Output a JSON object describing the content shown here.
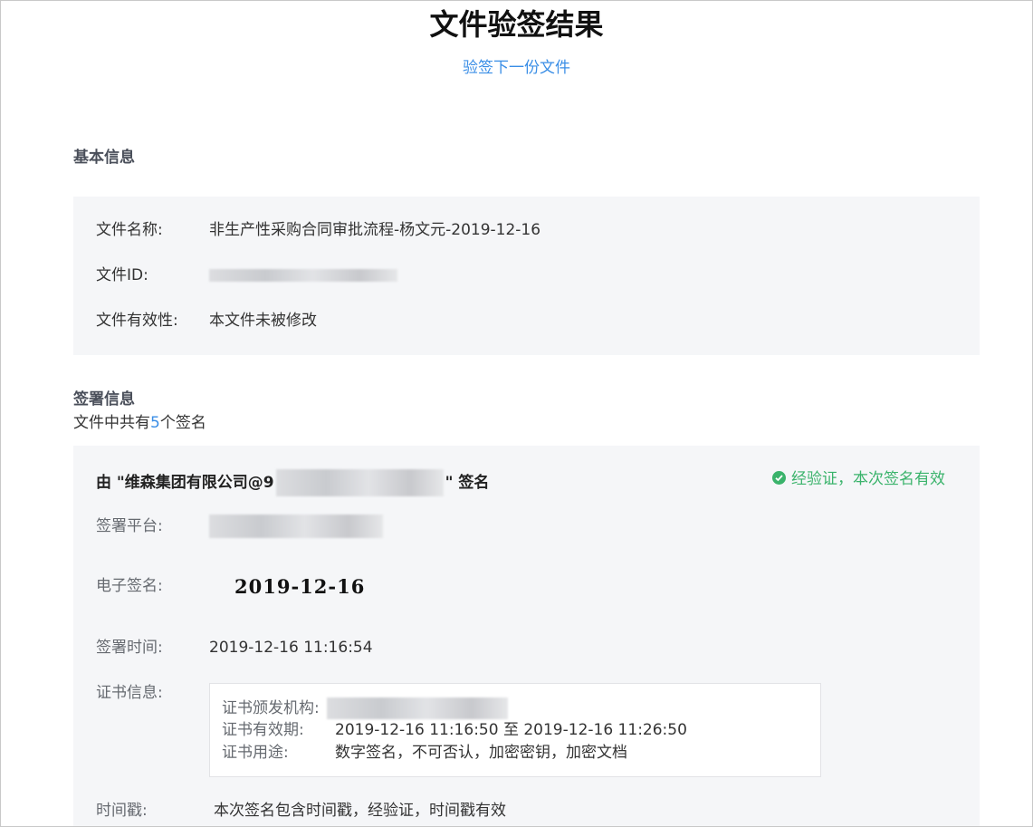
{
  "page": {
    "title": "文件验签结果",
    "next_link": "验签下一份文件"
  },
  "basic_info": {
    "heading": "基本信息",
    "rows": [
      {
        "label": "文件名称:",
        "value": "非生产性采购合同审批流程-杨文元-2019-12-16"
      },
      {
        "label": "文件ID:",
        "value": ""
      },
      {
        "label": "文件有效性:",
        "value": "本文件未被修改"
      }
    ]
  },
  "signature_info": {
    "heading": "签署信息",
    "count_prefix": "文件中共有",
    "count": "5",
    "count_suffix": "个签名",
    "signature": {
      "header_prefix": "由 \"维森集团有限公司@9",
      "header_suffix": "\" 签名",
      "status": "经验证，本次签名有效",
      "platform_label": "签署平台:",
      "esign_label": "电子签名:",
      "esign_value": "2019-12-16",
      "time_label": "签署时间:",
      "time_value": "2019-12-16 11:16:54",
      "cert_label": "证书信息:",
      "cert": {
        "issuer_label": "证书颁发机构:",
        "validity_label": "证书有效期:",
        "validity_value": "2019-12-16 11:16:50 至 2019-12-16 11:26:50",
        "usage_label": "证书用途:",
        "usage_value": "数字签名，不可否认，加密密钥，加密文档"
      },
      "timestamp_label": "时间戳:",
      "timestamp_value": "本次签名包含时间戳，经验证，时间戳有效"
    }
  },
  "colors": {
    "link": "#3a8ee6",
    "success": "#3ab36b",
    "panel_bg": "#f5f6f8"
  }
}
